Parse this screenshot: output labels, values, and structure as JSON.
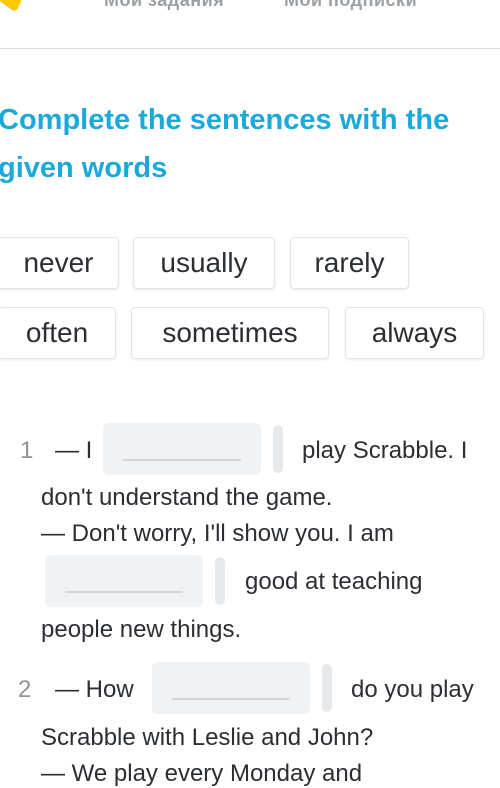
{
  "header": {
    "nav_items": [
      {
        "label": "Мои задания"
      },
      {
        "label": "Мои подписки"
      }
    ]
  },
  "exercise": {
    "title_line1": "Complete the sentences with the",
    "title_line2": "given words",
    "word_bank": [
      "never",
      "usually",
      "rarely",
      "often",
      "sometimes",
      "always"
    ],
    "questions": [
      {
        "number": "1",
        "segments": {
          "pre": "— I",
          "post1": "play Scrabble. I",
          "line2": "don't understand the game.",
          "line3": "— Don't worry, I'll show you. I am",
          "post2": "good at teaching",
          "line5": "people new things."
        },
        "blanks": [
          "",
          ""
        ]
      },
      {
        "number": "2",
        "segments": {
          "pre": "— How",
          "post1": "do you play",
          "line2": "Scrabble with Leslie and John?",
          "line3": "— We play every Monday and"
        },
        "blanks": [
          ""
        ]
      }
    ]
  },
  "colors": {
    "title": "#1ba9db",
    "text": "#2b2f33",
    "number": "#8f9499",
    "blank_bg": "#eff3f5"
  }
}
